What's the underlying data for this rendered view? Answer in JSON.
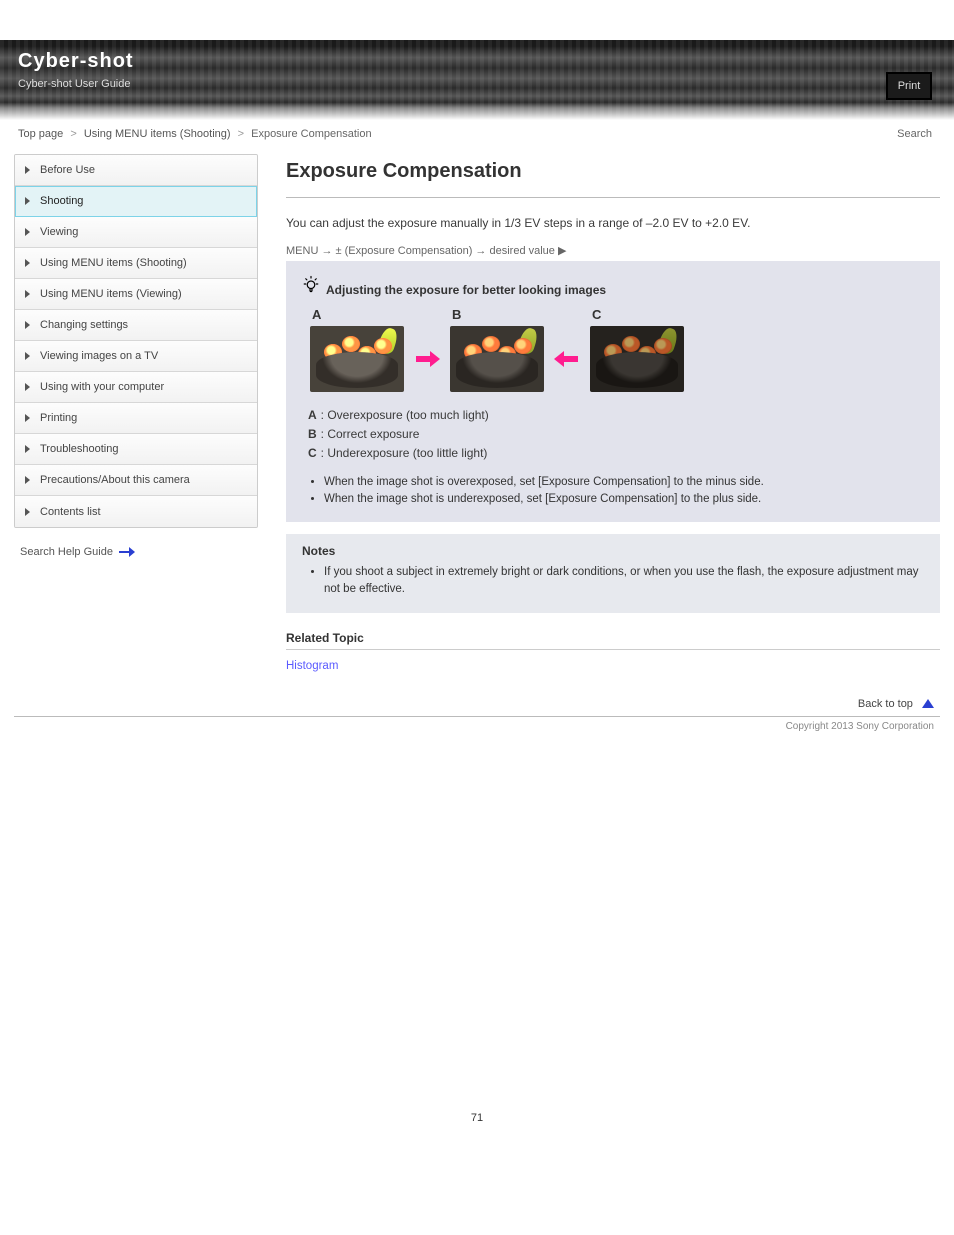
{
  "header": {
    "brand": "Cyber-shot",
    "subtitle": "Cyber-shot User Guide",
    "print_label": "Print"
  },
  "breadcrumb": {
    "top": "Top page",
    "section": "Using MENU items (Shooting)",
    "page": "Exposure Compensation",
    "right_label": "Search"
  },
  "sidebar": {
    "items": [
      {
        "label": "Before Use"
      },
      {
        "label": "Shooting"
      },
      {
        "label": "Viewing"
      },
      {
        "label": "Using MENU items (Shooting)"
      },
      {
        "label": "Using MENU items (Viewing)"
      },
      {
        "label": "Changing settings"
      },
      {
        "label": "Viewing images on a TV"
      },
      {
        "label": "Using with your computer"
      },
      {
        "label": "Printing"
      },
      {
        "label": "Troubleshooting"
      },
      {
        "label": "Precautions/About this camera"
      },
      {
        "label": "Contents list"
      }
    ],
    "selected_index": 1,
    "search_help_label": "Search Help Guide"
  },
  "main": {
    "title": "Exposure Compensation",
    "intro": "You can adjust the exposure manually in 1/3 EV steps in a range of –2.0 EV to +2.0 EV.",
    "menu_path_label": "MENU → ± (Exposure Compensation) → desired value ▶",
    "hint": {
      "title": "Adjusting the exposure for better looking images",
      "legend": {
        "a": "A",
        "b": "B",
        "c": "C"
      },
      "key_a_label": "A",
      "key_a_text": ": Overexposure (too much light)",
      "key_b_label": "B",
      "key_b_text": ": Correct exposure",
      "key_c_label": "C",
      "key_c_text": ": Underexposure (too little light)",
      "bullets": [
        "When the image shot is overexposed, set [Exposure Compensation] to the minus side.",
        "When the image shot is underexposed, set [Exposure Compensation] to the plus side."
      ]
    },
    "notes": {
      "title": "Notes",
      "items": [
        "If you shoot a subject in extremely bright or dark conditions, or when you use the flash, the exposure adjustment may not be effective."
      ]
    },
    "related": {
      "title": "Related Topic",
      "link": "Histogram"
    },
    "back_to_top": "Back to top"
  },
  "footer": {
    "copyright": "Copyright 2013 Sony Corporation",
    "page_number": "71"
  }
}
